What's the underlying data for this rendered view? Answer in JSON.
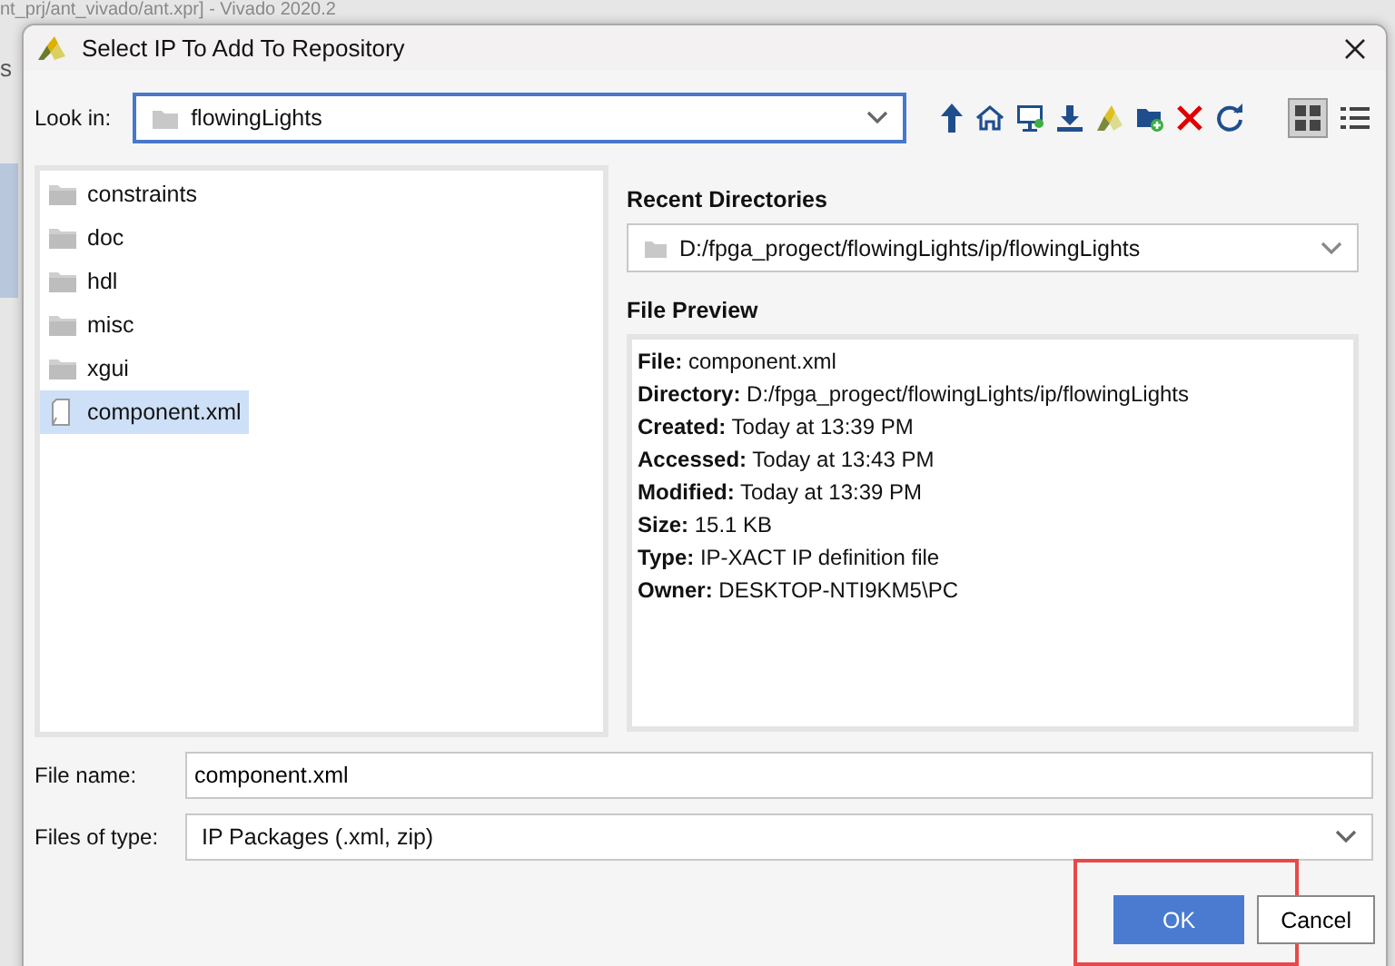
{
  "background_window": {
    "title": "nt_prj/ant_vivado/ant.xpr] - Vivado 2020.2",
    "side_text": "s"
  },
  "dialog": {
    "title": "Select IP To Add To Repository"
  },
  "look_in": {
    "label": "Look in:",
    "value": "flowingLights"
  },
  "view_modes": [
    {
      "selected": true
    },
    {
      "selected": false
    }
  ],
  "files": [
    {
      "name": "constraints",
      "kind": "folder",
      "selected": false
    },
    {
      "name": "doc",
      "kind": "folder",
      "selected": false
    },
    {
      "name": "hdl",
      "kind": "folder",
      "selected": false
    },
    {
      "name": "misc",
      "kind": "folder",
      "selected": false
    },
    {
      "name": "xgui",
      "kind": "folder",
      "selected": false
    },
    {
      "name": "component.xml",
      "kind": "file",
      "selected": true
    }
  ],
  "recent_directories": {
    "label": "Recent Directories",
    "value": "D:/fpga_progect/flowingLights/ip/flowingLights"
  },
  "file_preview": {
    "label": "File Preview",
    "lines": [
      "**File:** component.xml",
      "**Directory:** D:/fpga_progect/flowingLights/ip/flowingLights",
      "**Created:** Today at 13:39 PM",
      "**Accessed:** Today at 13:43 PM",
      "**Modified:** Today at 13:39 PM",
      "**Size:** 15.1 KB",
      "**Type:** IP-XACT IP definition file",
      "**Owner:** DESKTOP-NTI9KM5\\PC"
    ]
  },
  "file_name": {
    "label": "File name:",
    "value": "component.xml"
  },
  "files_of_type": {
    "label": "Files of type:",
    "value": "IP Packages (.xml, zip)"
  },
  "buttons": [
    {
      "label": "OK",
      "kind": "primary",
      "highlighted": true
    },
    {
      "label": "Cancel",
      "kind": "secondary",
      "highlighted": false
    }
  ]
}
